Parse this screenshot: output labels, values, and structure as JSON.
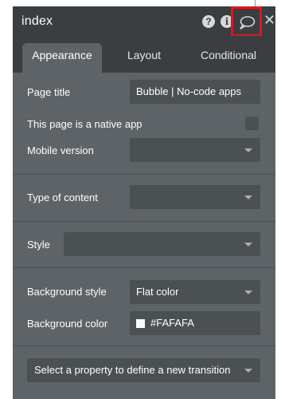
{
  "window": {
    "title": "index"
  },
  "header_icons": {
    "help": "question-mark-icon",
    "info": "info-icon",
    "comment": "comment-bubble-icon",
    "close": "close-icon"
  },
  "tabs": [
    {
      "label": "Appearance",
      "active": true
    },
    {
      "label": "Layout",
      "active": false
    },
    {
      "label": "Conditional",
      "active": false
    }
  ],
  "fields": {
    "page_title": {
      "label": "Page title",
      "value": "Bubble | No-code apps"
    },
    "native_app": {
      "label": "This page is a native app",
      "checked": false
    },
    "mobile_version": {
      "label": "Mobile version",
      "value": ""
    },
    "type_of_content": {
      "label": "Type of content",
      "value": ""
    },
    "style": {
      "label": "Style",
      "value": ""
    },
    "background_style": {
      "label": "Background style",
      "value": "Flat color"
    },
    "background_color": {
      "label": "Background color",
      "value": "#FAFAFA"
    },
    "transition": {
      "placeholder": "Select a property to define a new transition"
    }
  },
  "colors": {
    "panel": "#5d6367",
    "header": "#3a3e41",
    "field": "#4b5053",
    "highlight": "#e0161d",
    "swatch": "#FAFAFA"
  }
}
